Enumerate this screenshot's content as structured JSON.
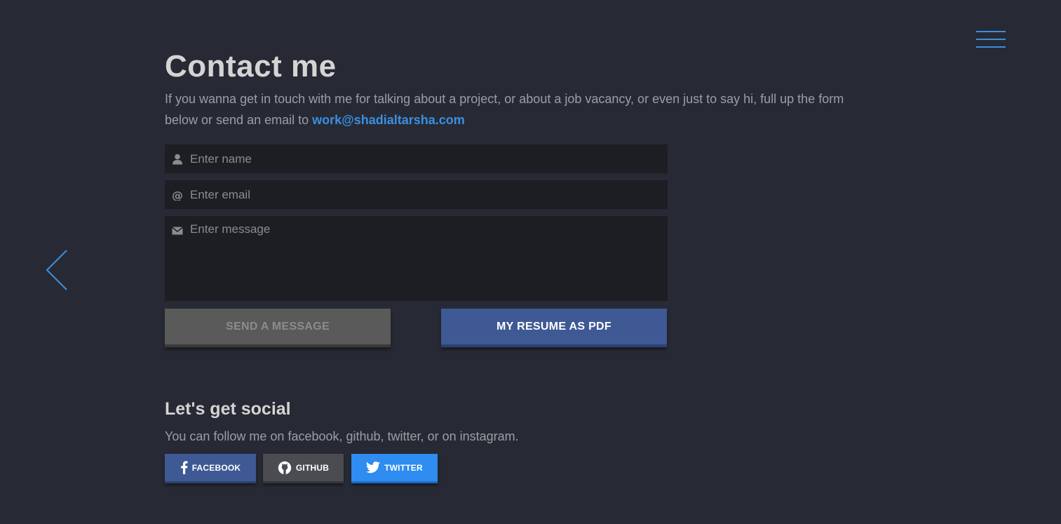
{
  "header": {
    "menu_icon": "hamburger-icon",
    "back_icon": "chevron-left-icon",
    "accent_color": "#3b8fe0"
  },
  "contact": {
    "title": "Contact me",
    "intro_text": "If you wanna get in touch with me for talking about a project, or about a job vacancy, or even just to say hi, full up the form below or send an email to ",
    "email": "work@shadialtarsha.com"
  },
  "form": {
    "name_placeholder": "Enter name",
    "email_placeholder": "Enter email",
    "message_placeholder": "Enter message",
    "name_icon": "user-icon",
    "email_icon": "at-icon",
    "message_icon": "envelope-icon",
    "send_label": "SEND A MESSAGE",
    "resume_label": "MY RESUME AS PDF"
  },
  "social": {
    "title": "Let's get social",
    "text": "You can follow me on facebook, github, twitter, or on instagram.",
    "facebook_label": "FACEBOOK",
    "github_label": "GITHUB",
    "twitter_label": "TWITTER",
    "facebook_color": "#3f5994",
    "github_color": "#4a4c52",
    "twitter_color": "#2f8cf0"
  }
}
